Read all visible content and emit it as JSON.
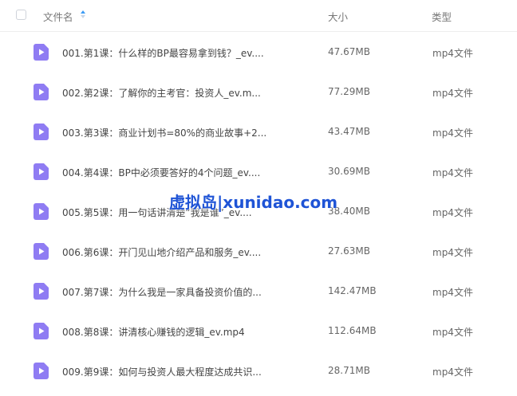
{
  "header": {
    "name_label": "文件名",
    "size_label": "大小",
    "type_label": "类型"
  },
  "colors": {
    "icon_purple": "#8f7cf3",
    "watermark_blue": "#1f54d6"
  },
  "files": [
    {
      "name": "001.第1课：什么样的BP最容易拿到钱？_ev....",
      "size": "47.67MB",
      "type": "mp4文件"
    },
    {
      "name": "002.第2课：了解你的主考官：投资人_ev.m...",
      "size": "77.29MB",
      "type": "mp4文件"
    },
    {
      "name": "003.第3课：商业计划书=80%的商业故事+2...",
      "size": "43.47MB",
      "type": "mp4文件"
    },
    {
      "name": "004.第4课：BP中必须要答好的4个问题_ev....",
      "size": "30.69MB",
      "type": "mp4文件"
    },
    {
      "name": "005.第5课：用一句话讲清楚“我是谁”_ev....",
      "size": "38.40MB",
      "type": "mp4文件"
    },
    {
      "name": "006.第6课：开门见山地介绍产品和服务_ev....",
      "size": "27.63MB",
      "type": "mp4文件"
    },
    {
      "name": "007.第7课：为什么我是一家具备投资价值的...",
      "size": "142.47MB",
      "type": "mp4文件"
    },
    {
      "name": "008.第8课：讲清核心赚钱的逻辑_ev.mp4",
      "size": "112.64MB",
      "type": "mp4文件"
    },
    {
      "name": "009.第9课：如何与投资人最大程度达成共识...",
      "size": "28.71MB",
      "type": "mp4文件"
    }
  ],
  "watermark": {
    "text": "虚拟岛|xunidao.com"
  }
}
